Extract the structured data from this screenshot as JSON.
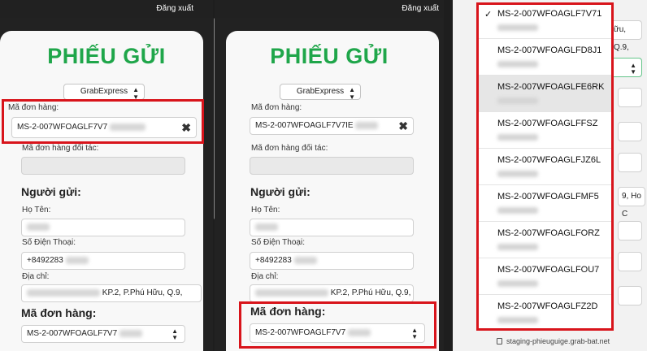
{
  "common": {
    "logout": "Đăng xuất",
    "title": "PHIẾU GỬI",
    "courier": "GrabExpress",
    "order_label": "Mã đơn hàng:",
    "partner_label": "Mã đơn hàng đối tác:",
    "sender_heading": "Người gửi:",
    "name_label": "Họ Tên:",
    "phone_label": "Số Điện Thoại:",
    "address_label": "Địa chỉ:",
    "address_tail": "KP.2, P.Phú Hữu, Q.9,",
    "phone_value": "+849228",
    "order_heading": "Mã đơn hàng:"
  },
  "panel1": {
    "order_value": "MS-2-007WFOAGLF7V7",
    "phone_value": "+8492283",
    "order_select": "MS-2-007WFOAGLF7V7"
  },
  "panel2": {
    "order_value": "MS-2-007WFOAGLF7V7IE",
    "phone_value": "+8492283",
    "order_select": "MS-2-007WFOAGLF7V7"
  },
  "panel3": {
    "bg_text_1": "ữu, Q.9,",
    "bg_text_2": "9, Ho C",
    "url": "staging-phieuguige.grab-bat.net",
    "checkmark": "✓",
    "dropdown": [
      "MS-2-007WFOAGLF7V71",
      "MS-2-007WFOAGLFD8J1",
      "MS-2-007WFOAGLFE6RK",
      "MS-2-007WFOAGLFFSZ",
      "MS-2-007WFOAGLFJZ6L",
      "MS-2-007WFOAGLFMF5",
      "MS-2-007WFOAGLFORZ",
      "MS-2-007WFOAGLFOU7",
      "MS-2-007WFOAGLFZ2D"
    ]
  },
  "colors": {
    "title_green": "#1fa64a",
    "highlight_red": "#d8141b"
  }
}
